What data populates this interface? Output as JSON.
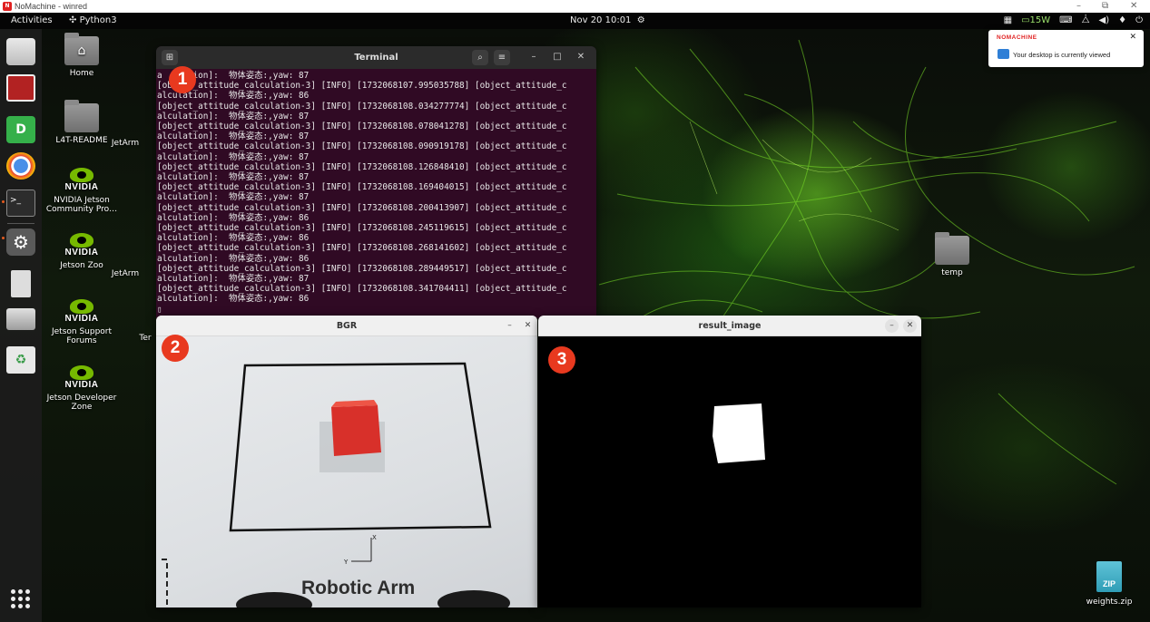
{
  "nomachine": {
    "title": "NoMachine - winred",
    "logo_text": "N",
    "controls": [
      "–",
      "⧉",
      "✕"
    ]
  },
  "topbar": {
    "activities": "Activities",
    "app_menu": "Python3",
    "clock": "Nov 20  10:01",
    "tray": {
      "power": "15W"
    }
  },
  "desktop_icons": [
    {
      "label": "Home"
    },
    {
      "label": "L4T-README"
    },
    {
      "label": "NVIDIA Jetson Community Pro…"
    },
    {
      "label": "Jetson Zoo"
    },
    {
      "label": "Jetson Support Forums"
    },
    {
      "label": "Jetson Developer Zone"
    },
    {
      "label": "temp"
    },
    {
      "label": "weights.zip"
    }
  ],
  "nvidia_wordmark": "NVIDIA",
  "partial_labels": [
    "JetArm",
    "JetArm",
    "Ter"
  ],
  "terminal": {
    "title": "Terminal",
    "lines": [
      "a    ation]:  物体姿态:,yaw: 87",
      "[object_attitude_calculation-3] [INFO] [1732068107.995035788] [object_attitude_c",
      "alculation]:  物体姿态:,yaw: 86",
      "[object_attitude_calculation-3] [INFO] [1732068108.034277774] [object_attitude_c",
      "alculation]:  物体姿态:,yaw: 87",
      "[object_attitude_calculation-3] [INFO] [1732068108.078041278] [object_attitude_c",
      "alculation]:  物体姿态:,yaw: 87",
      "[object_attitude_calculation-3] [INFO] [1732068108.090919178] [object_attitude_c",
      "alculation]:  物体姿态:,yaw: 87",
      "[object_attitude_calculation-3] [INFO] [1732068108.126848410] [object_attitude_c",
      "alculation]:  物体姿态:,yaw: 87",
      "[object_attitude_calculation-3] [INFO] [1732068108.169404015] [object_attitude_c",
      "alculation]:  物体姿态:,yaw: 87",
      "[object_attitude_calculation-3] [INFO] [1732068108.200413907] [object_attitude_c",
      "alculation]:  物体姿态:,yaw: 86",
      "[object_attitude_calculation-3] [INFO] [1732068108.245119615] [object_attitude_c",
      "alculation]:  物体姿态:,yaw: 86",
      "[object_attitude_calculation-3] [INFO] [1732068108.268141602] [object_attitude_c",
      "alculation]:  物体姿态:,yaw: 86",
      "[object_attitude_calculation-3] [INFO] [1732068108.289449517] [object_attitude_c",
      "alculation]:  物体姿态:,yaw: 87",
      "[object_attitude_calculation-3] [INFO] [1732068108.341704411] [object_attitude_c",
      "alculation]:  物体姿态:,yaw: 86",
      "▯"
    ]
  },
  "bgr_window": {
    "title": "BGR",
    "controls": [
      "–",
      "✕"
    ],
    "camera_label": "Robotic Arm",
    "axis_labels": {
      "y": "Y",
      "x": "X"
    }
  },
  "result_window": {
    "title": "result_image",
    "controls": [
      "–",
      "✕"
    ]
  },
  "markers": [
    "1",
    "2",
    "3"
  ],
  "notification": {
    "brand": "NOMACHINE",
    "message": "Your desktop is currently viewed",
    "close": "✕"
  },
  "zip_badge": "ZIP",
  "colors": {
    "terminal_bg": "#300a24",
    "marker": "#e8391f",
    "nvidia_green": "#76b900",
    "cube": "#d8302a"
  }
}
